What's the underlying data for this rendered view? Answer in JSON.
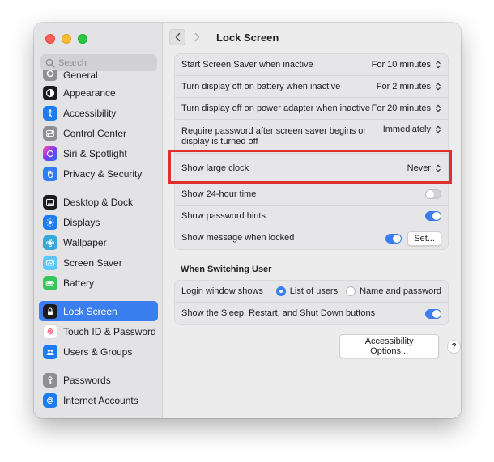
{
  "window": {
    "title": "Lock Screen"
  },
  "search": {
    "placeholder": "Search"
  },
  "sidebar": {
    "partial_label": "General",
    "groups": [
      [
        {
          "label": "Appearance",
          "icon": "appearance-icon",
          "color": "#1c1c1e"
        },
        {
          "label": "Accessibility",
          "icon": "accessibility-icon",
          "color": "#1d7cf2"
        },
        {
          "label": "Control Center",
          "icon": "control-center-icon",
          "color": "#8e8e93"
        },
        {
          "label": "Siri & Spotlight",
          "icon": "siri-icon",
          "color": "#7c3aed"
        },
        {
          "label": "Privacy & Security",
          "icon": "hand-icon",
          "color": "#2f7df6"
        }
      ],
      [
        {
          "label": "Desktop & Dock",
          "icon": "dock-icon",
          "color": "#1c1c1e"
        },
        {
          "label": "Displays",
          "icon": "displays-icon",
          "color": "#1d7cf2"
        },
        {
          "label": "Wallpaper",
          "icon": "wallpaper-icon",
          "color": "#34aadc"
        },
        {
          "label": "Screen Saver",
          "icon": "screen-saver-icon",
          "color": "#5ac8fa"
        },
        {
          "label": "Battery",
          "icon": "battery-icon",
          "color": "#34c759"
        }
      ],
      [
        {
          "label": "Lock Screen",
          "icon": "lock-icon",
          "color": "#1c1c1e",
          "selected": true
        },
        {
          "label": "Touch ID & Password",
          "icon": "fingerprint-icon",
          "color": "#ffffff"
        },
        {
          "label": "Users & Groups",
          "icon": "users-icon",
          "color": "#1d7cf2"
        }
      ],
      [
        {
          "label": "Passwords",
          "icon": "key-icon",
          "color": "#8e8e93"
        },
        {
          "label": "Internet Accounts",
          "icon": "at-icon",
          "color": "#1d7cf2"
        }
      ]
    ]
  },
  "settings": {
    "screen_saver": {
      "label": "Start Screen Saver when inactive",
      "value": "For 10 minutes"
    },
    "display_battery": {
      "label": "Turn display off on battery when inactive",
      "value": "For 2 minutes"
    },
    "display_adapter": {
      "label": "Turn display off on power adapter when inactive",
      "value": "For 20 minutes"
    },
    "require_password": {
      "label_line1": "Require password after screen saver begins or",
      "label_line2": "display is turned off",
      "value": "Immediately"
    },
    "large_clock": {
      "label": "Show large clock",
      "value": "Never"
    },
    "hour24": {
      "label": "Show 24-hour time",
      "on": false
    },
    "password_hints": {
      "label": "Show password hints",
      "on": true
    },
    "message_locked": {
      "label": "Show message when locked",
      "on": true,
      "button": "Set..."
    }
  },
  "switching": {
    "title": "When Switching User",
    "login_window": {
      "label": "Login window shows",
      "options": [
        "List of users",
        "Name and password"
      ],
      "selected": 0
    },
    "sleep_buttons": {
      "label": "Show the Sleep, Restart, and Shut Down buttons",
      "on": true
    }
  },
  "footer": {
    "accessibility_button": "Accessibility Options...",
    "help": "?"
  },
  "colors": {
    "accent": "#3a7ef0",
    "highlight": "#e0302b"
  }
}
